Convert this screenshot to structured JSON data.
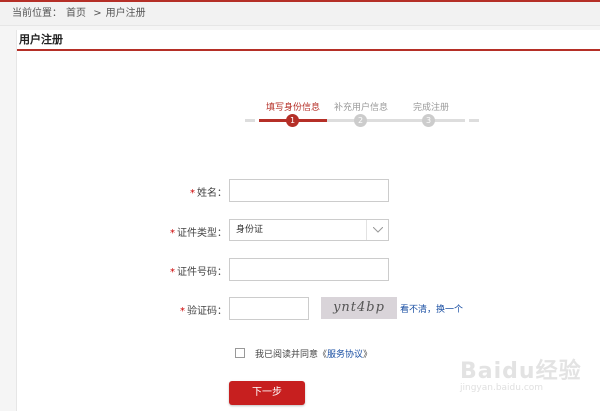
{
  "breadcrumb": {
    "prefix": "当前位置：",
    "home": "首页",
    "separator": ">",
    "current": "用户注册"
  },
  "panel": {
    "title": "用户注册"
  },
  "steps": [
    {
      "label": "填写身份信息",
      "number": "1",
      "active": true
    },
    {
      "label": "补充用户信息",
      "number": "2",
      "active": false
    },
    {
      "label": "完成注册",
      "number": "3",
      "active": false
    }
  ],
  "form": {
    "required_mark": "*",
    "name_label": "姓名：",
    "name_value": "",
    "id_type_label": "证件类型：",
    "id_type_value": "身份证",
    "id_number_label": "证件号码：",
    "id_number_value": "",
    "captcha_label": "验证码：",
    "captcha_value": "",
    "captcha_image_text": "ynt4bp",
    "captcha_refresh": "看不清，换一个"
  },
  "agreement": {
    "text": "我已阅读并同意《",
    "link": "服务协议",
    "suffix": "》",
    "checked": false
  },
  "next_button": "下一步",
  "watermark": {
    "main": "Baidu经验",
    "sub": "jingyan.baidu.com"
  },
  "colors": {
    "brand_red": "#b52f27",
    "button_red": "#c71f1f",
    "link_blue": "#1a4fa3"
  }
}
